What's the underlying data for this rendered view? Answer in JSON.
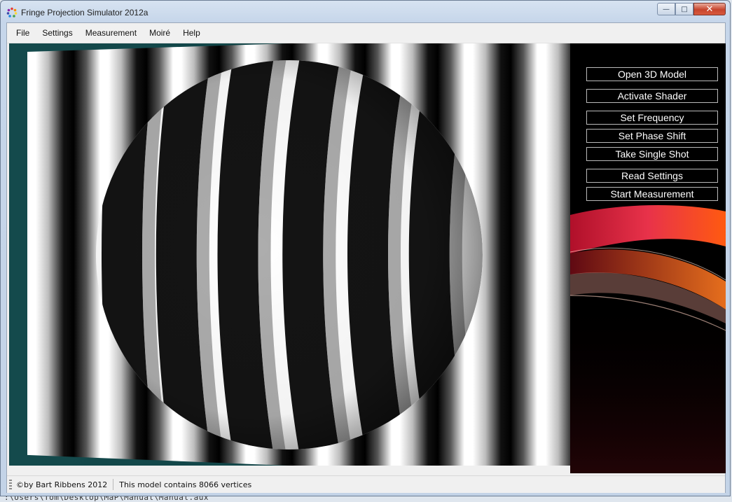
{
  "window": {
    "title": "Fringe Projection Simulator 2012a",
    "caption_buttons": {
      "minimize": "—",
      "maximize": "□",
      "close": "✕"
    }
  },
  "menu": {
    "items": [
      "File",
      "Settings",
      "Measurement",
      "Moiré",
      "Help"
    ]
  },
  "panel": {
    "buttons": [
      "Open 3D Model",
      "Activate Shader",
      "Set Frequency",
      "Set Phase Shift",
      "Take Single Shot",
      "Read Settings",
      "Start Measurement"
    ]
  },
  "status": {
    "copyright": "©by Bart Ribbens 2012",
    "vertex_info": "This model contains 8066 vertices"
  },
  "background_text": ":\\Users\\Tom\\Desktop\\MaP\\Manual\\Manual.aux",
  "colors": {
    "accent_red": "#d82840",
    "accent_orange": "#ff6a10",
    "viewport_bg": "#0f3f42"
  },
  "icons": {
    "app": "app-color-wheel-icon"
  }
}
